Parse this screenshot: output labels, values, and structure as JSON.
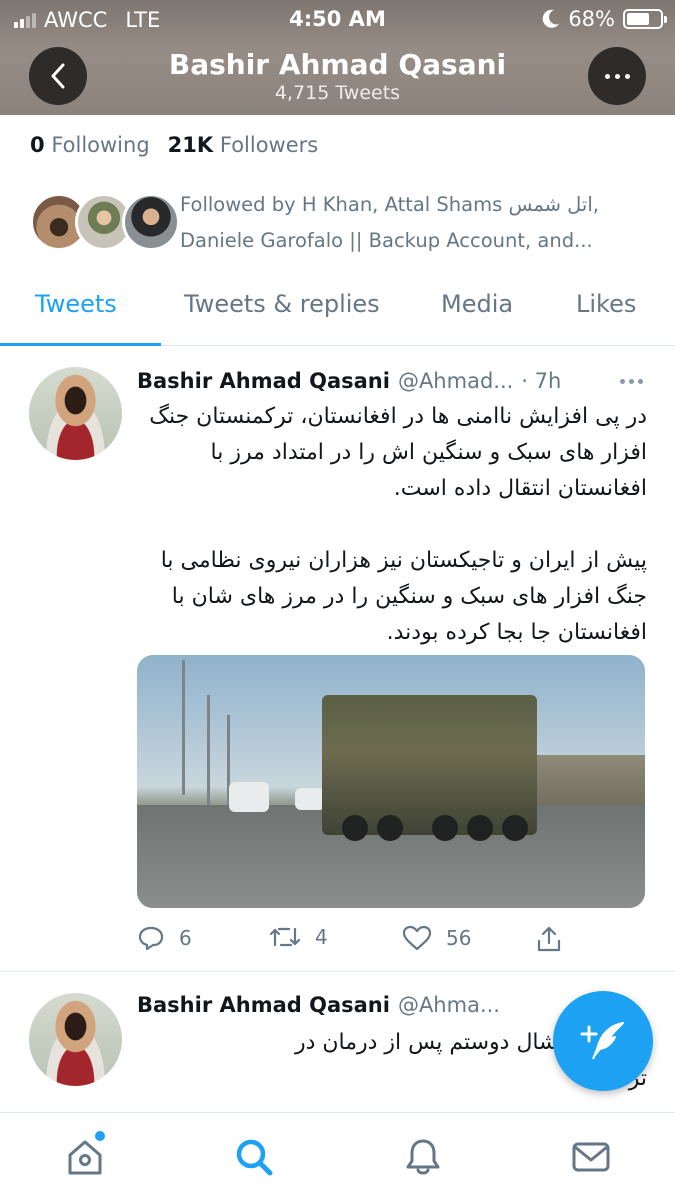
{
  "status_bar": {
    "carrier": "AWCC",
    "network": "LTE",
    "time": "4:50 AM",
    "battery_percent": "68%",
    "battery_level": 0.68
  },
  "header": {
    "title": "Bashir Ahmad Qasani",
    "subtitle": "4,715 Tweets",
    "back_icon": "chevron-left-icon",
    "more_icon": "more-horizontal-icon"
  },
  "profile": {
    "following_count": "0",
    "following_label": "Following",
    "followers_count": "21K",
    "followers_label": "Followers",
    "followed_by_line1": "Followed by H Khan, Attal Shams اتل شمس,",
    "followed_by_line2": "Daniele Garofalo || Backup Account, and..."
  },
  "tabs": [
    {
      "label": "Tweets",
      "active": true
    },
    {
      "label": "Tweets & replies",
      "active": false
    },
    {
      "label": "Media",
      "active": false
    },
    {
      "label": "Likes",
      "active": false
    }
  ],
  "tweets": [
    {
      "name": "Bashir Ahmad Qasani",
      "handle": "@Ahmad...",
      "time": "· 7h",
      "text": "در پی افزایش ناامنی ها در افغانستان، ترکمنستان جنگ افزار های سبک و سنگین اش را در امتداد مرز با افغانستان انتقال داده است.\n\nپیش از ایران و تاجیکستان نیز هزاران نیروی نظامی با جنگ افزار های سبک و سنگین را در مرز های شان با افغانستان جا بجا کرده بودند.",
      "reply_count": "6",
      "retweet_count": "4",
      "like_count": "56"
    },
    {
      "name": "Bashir Ahmad Qasani",
      "handle": "@Ahma...",
      "text": "عکس مارشال دوستم پس از درمان در\nتر"
    }
  ],
  "colors": {
    "accent": "#1da1f2",
    "text_primary": "#14171a",
    "text_secondary": "#657786",
    "border": "#e1e8ed"
  },
  "nav": [
    "home-icon",
    "search-icon",
    "bell-icon",
    "mail-icon"
  ]
}
